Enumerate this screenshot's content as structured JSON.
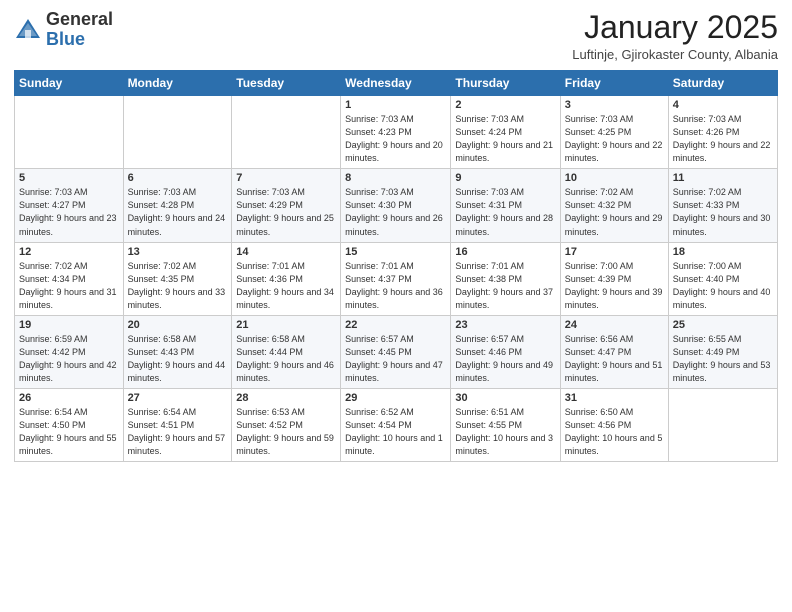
{
  "header": {
    "logo_general": "General",
    "logo_blue": "Blue",
    "month_title": "January 2025",
    "subtitle": "Luftinje, Gjirokaster County, Albania"
  },
  "weekdays": [
    "Sunday",
    "Monday",
    "Tuesday",
    "Wednesday",
    "Thursday",
    "Friday",
    "Saturday"
  ],
  "weeks": [
    [
      {
        "day": "",
        "info": ""
      },
      {
        "day": "",
        "info": ""
      },
      {
        "day": "",
        "info": ""
      },
      {
        "day": "1",
        "info": "Sunrise: 7:03 AM\nSunset: 4:23 PM\nDaylight: 9 hours\nand 20 minutes."
      },
      {
        "day": "2",
        "info": "Sunrise: 7:03 AM\nSunset: 4:24 PM\nDaylight: 9 hours\nand 21 minutes."
      },
      {
        "day": "3",
        "info": "Sunrise: 7:03 AM\nSunset: 4:25 PM\nDaylight: 9 hours\nand 22 minutes."
      },
      {
        "day": "4",
        "info": "Sunrise: 7:03 AM\nSunset: 4:26 PM\nDaylight: 9 hours\nand 22 minutes."
      }
    ],
    [
      {
        "day": "5",
        "info": "Sunrise: 7:03 AM\nSunset: 4:27 PM\nDaylight: 9 hours\nand 23 minutes."
      },
      {
        "day": "6",
        "info": "Sunrise: 7:03 AM\nSunset: 4:28 PM\nDaylight: 9 hours\nand 24 minutes."
      },
      {
        "day": "7",
        "info": "Sunrise: 7:03 AM\nSunset: 4:29 PM\nDaylight: 9 hours\nand 25 minutes."
      },
      {
        "day": "8",
        "info": "Sunrise: 7:03 AM\nSunset: 4:30 PM\nDaylight: 9 hours\nand 26 minutes."
      },
      {
        "day": "9",
        "info": "Sunrise: 7:03 AM\nSunset: 4:31 PM\nDaylight: 9 hours\nand 28 minutes."
      },
      {
        "day": "10",
        "info": "Sunrise: 7:02 AM\nSunset: 4:32 PM\nDaylight: 9 hours\nand 29 minutes."
      },
      {
        "day": "11",
        "info": "Sunrise: 7:02 AM\nSunset: 4:33 PM\nDaylight: 9 hours\nand 30 minutes."
      }
    ],
    [
      {
        "day": "12",
        "info": "Sunrise: 7:02 AM\nSunset: 4:34 PM\nDaylight: 9 hours\nand 31 minutes."
      },
      {
        "day": "13",
        "info": "Sunrise: 7:02 AM\nSunset: 4:35 PM\nDaylight: 9 hours\nand 33 minutes."
      },
      {
        "day": "14",
        "info": "Sunrise: 7:01 AM\nSunset: 4:36 PM\nDaylight: 9 hours\nand 34 minutes."
      },
      {
        "day": "15",
        "info": "Sunrise: 7:01 AM\nSunset: 4:37 PM\nDaylight: 9 hours\nand 36 minutes."
      },
      {
        "day": "16",
        "info": "Sunrise: 7:01 AM\nSunset: 4:38 PM\nDaylight: 9 hours\nand 37 minutes."
      },
      {
        "day": "17",
        "info": "Sunrise: 7:00 AM\nSunset: 4:39 PM\nDaylight: 9 hours\nand 39 minutes."
      },
      {
        "day": "18",
        "info": "Sunrise: 7:00 AM\nSunset: 4:40 PM\nDaylight: 9 hours\nand 40 minutes."
      }
    ],
    [
      {
        "day": "19",
        "info": "Sunrise: 6:59 AM\nSunset: 4:42 PM\nDaylight: 9 hours\nand 42 minutes."
      },
      {
        "day": "20",
        "info": "Sunrise: 6:58 AM\nSunset: 4:43 PM\nDaylight: 9 hours\nand 44 minutes."
      },
      {
        "day": "21",
        "info": "Sunrise: 6:58 AM\nSunset: 4:44 PM\nDaylight: 9 hours\nand 46 minutes."
      },
      {
        "day": "22",
        "info": "Sunrise: 6:57 AM\nSunset: 4:45 PM\nDaylight: 9 hours\nand 47 minutes."
      },
      {
        "day": "23",
        "info": "Sunrise: 6:57 AM\nSunset: 4:46 PM\nDaylight: 9 hours\nand 49 minutes."
      },
      {
        "day": "24",
        "info": "Sunrise: 6:56 AM\nSunset: 4:47 PM\nDaylight: 9 hours\nand 51 minutes."
      },
      {
        "day": "25",
        "info": "Sunrise: 6:55 AM\nSunset: 4:49 PM\nDaylight: 9 hours\nand 53 minutes."
      }
    ],
    [
      {
        "day": "26",
        "info": "Sunrise: 6:54 AM\nSunset: 4:50 PM\nDaylight: 9 hours\nand 55 minutes."
      },
      {
        "day": "27",
        "info": "Sunrise: 6:54 AM\nSunset: 4:51 PM\nDaylight: 9 hours\nand 57 minutes."
      },
      {
        "day": "28",
        "info": "Sunrise: 6:53 AM\nSunset: 4:52 PM\nDaylight: 9 hours\nand 59 minutes."
      },
      {
        "day": "29",
        "info": "Sunrise: 6:52 AM\nSunset: 4:54 PM\nDaylight: 10 hours\nand 1 minute."
      },
      {
        "day": "30",
        "info": "Sunrise: 6:51 AM\nSunset: 4:55 PM\nDaylight: 10 hours\nand 3 minutes."
      },
      {
        "day": "31",
        "info": "Sunrise: 6:50 AM\nSunset: 4:56 PM\nDaylight: 10 hours\nand 5 minutes."
      },
      {
        "day": "",
        "info": ""
      }
    ]
  ]
}
